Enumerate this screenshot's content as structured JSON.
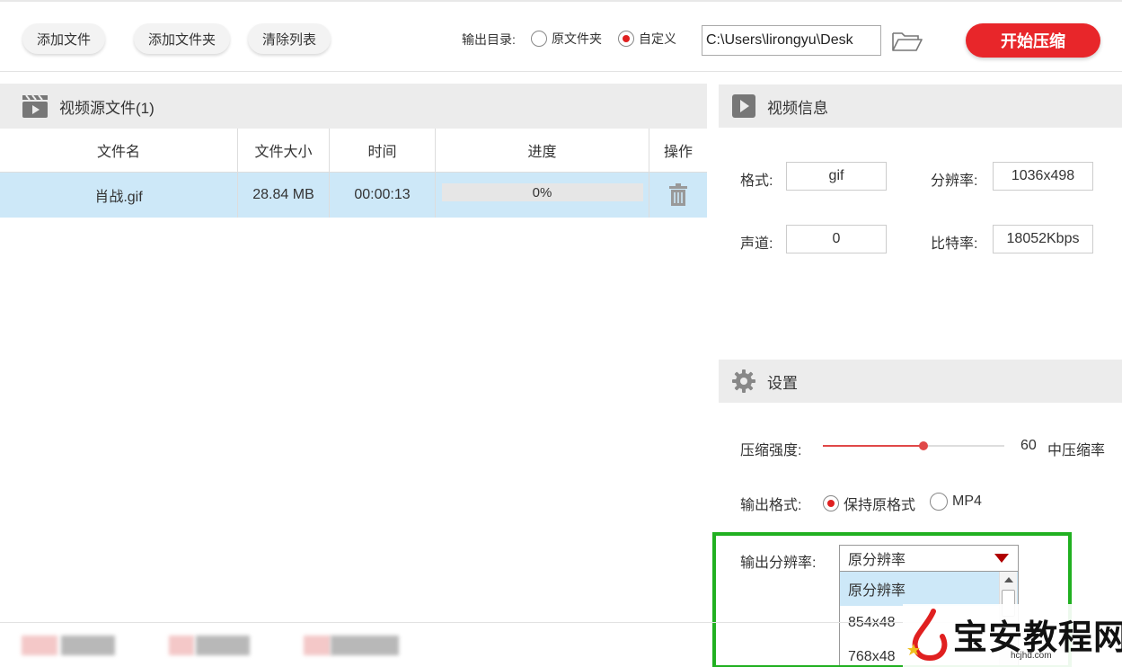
{
  "toolbar": {
    "add_file": "添加文件",
    "add_folder": "添加文件夹",
    "clear_list": "清除列表",
    "output_dir_label": "输出目录:",
    "radio_original": "原文件夹",
    "radio_custom": "自定义",
    "output_path": "C:\\Users\\lirongyu\\Desk",
    "start": "开始压缩",
    "selected_output": "自定义"
  },
  "files": {
    "title": "视频源文件(1)",
    "columns": [
      "文件名",
      "文件大小",
      "时间",
      "进度",
      "操作"
    ],
    "rows": [
      {
        "name": "肖战.gif",
        "size": "28.84 MB",
        "time": "00:00:13",
        "progress": "0%",
        "progress_value": 0
      }
    ]
  },
  "video_info": {
    "title": "视频信息",
    "format_label": "格式:",
    "format": "gif",
    "resolution_label": "分辨率:",
    "resolution": "1036x498",
    "channel_label": "声道:",
    "channel": "0",
    "bitrate_label": "比特率:",
    "bitrate": "18052Kbps"
  },
  "settings": {
    "title": "设置",
    "strength_label": "压缩强度:",
    "strength_value": "60",
    "strength_percent": 60,
    "strength_desc": "中压缩率",
    "format_label": "输出格式:",
    "format_keep": "保持原格式",
    "format_mp4": "MP4",
    "selected_format": "保持原格式",
    "resolution_label": "输出分辨率:",
    "resolution_selected": "原分辨率",
    "resolution_options": [
      "原分辨率",
      "854x48",
      "768x48"
    ]
  },
  "watermark": {
    "text": "宝安教程网",
    "url": "hcjhd.com"
  },
  "colors": {
    "accent": "#e8262a",
    "highlight": "#cde8f8",
    "annotation": "#21b021"
  }
}
